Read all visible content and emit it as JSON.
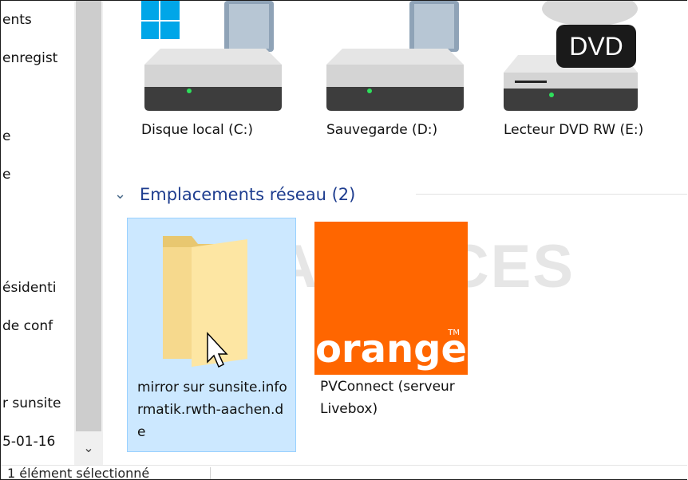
{
  "nav": {
    "items": [
      {
        "label": "ents"
      },
      {
        "label": "enregist"
      },
      {
        "label": "e"
      },
      {
        "label": "e"
      },
      {
        "label": "ésidenti"
      },
      {
        "label": "de conf"
      },
      {
        "label": "r sunsite"
      },
      {
        "label": "5-01-16"
      }
    ],
    "expand_glyph": "⌄"
  },
  "drives": [
    {
      "label": "Disque local (C:)",
      "icon": "hard-drive-windows-icon"
    },
    {
      "label": "Sauvegarde (D:)",
      "icon": "hard-drive-backup-icon"
    },
    {
      "label": "Lecteur DVD RW (E:)",
      "icon": "dvd-drive-icon",
      "badge": "DVD"
    }
  ],
  "network_group": {
    "chevron": "⌄",
    "title": "Emplacements réseau (2)",
    "items": [
      {
        "label": "mirror sur sunsite.informatik.rwth-aachen.de",
        "icon": "folder-icon",
        "selected": true
      },
      {
        "label": "PVConnect (serveur Livebox)",
        "icon": "orange-logo-icon",
        "logo_text": "orange",
        "tm": "TM"
      }
    ]
  },
  "watermark": {
    "text": "PC ASTUCES"
  },
  "status": {
    "text": "1 élément sélectionné"
  },
  "colors": {
    "selection_bg": "#cce8ff",
    "selection_border": "#99d1ff",
    "orange": "#ff6600",
    "group_title": "#1e3d8f"
  }
}
